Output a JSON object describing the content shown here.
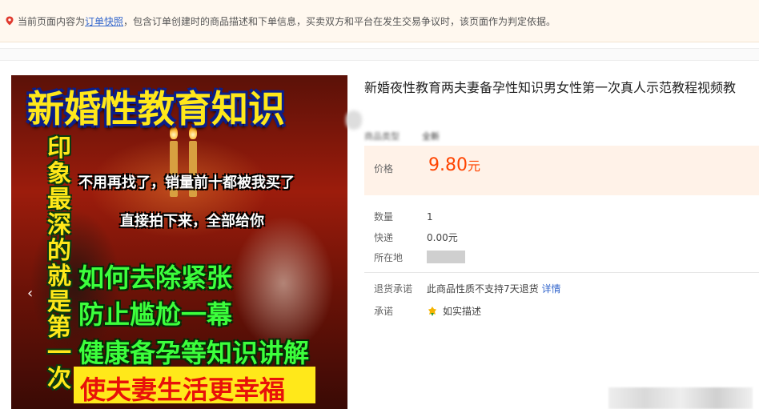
{
  "notice": {
    "prefix": "当前页面内容为",
    "link": "订单快照",
    "suffix": "，包含订单创建时的商品描述和下单信息，买卖双方和平台在发生交易争议时，该页面作为判定依据。"
  },
  "image": {
    "headline": "新婚性教育知识",
    "vertical": "印象最深的就是第一次",
    "line_white_1": "不用再找了，销量前十都被我买了",
    "line_white_2": "直接拍下来，全部给你",
    "line_green_1": "如何去除紧张",
    "line_green_2": "防止尴尬一幕",
    "line_green_3": "健康备孕等知识讲解",
    "banner": "使夫妻生活更幸福",
    "prev_arrow": "‹"
  },
  "product": {
    "title": "新婚夜性教育两夫妻备孕性知识男女性第一次真人示范教程视频教",
    "condition_label": "商品类型",
    "condition_value": "全新",
    "price_label": "价格",
    "price_value": "9.80",
    "price_unit": "元",
    "quantity_label": "数量",
    "quantity_value": "1",
    "shipping_label": "快递",
    "shipping_value": "0.00元",
    "location_label": "所在地",
    "return_label": "退货承诺",
    "return_value": "此商品性质不支持7天退货",
    "return_link": "详情",
    "promise_label": "承诺",
    "promise_value": "如实描述"
  },
  "colors": {
    "price": "#ff4400",
    "link": "#3366cc",
    "price_bg": "#fff2e8"
  }
}
